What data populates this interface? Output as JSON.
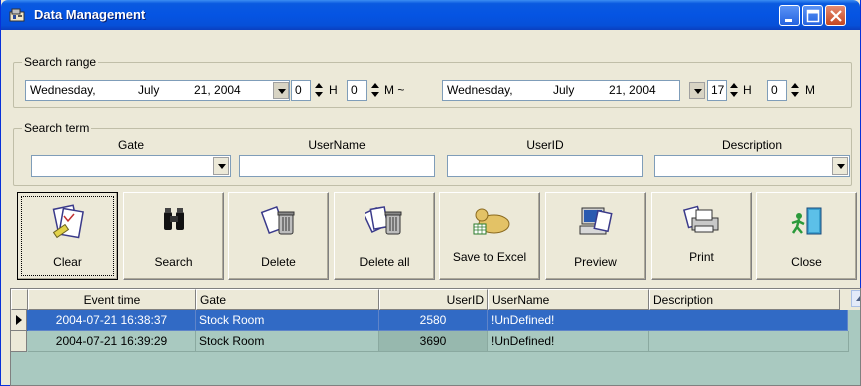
{
  "window": {
    "title": "Data Management",
    "minimize_icon": "minimize-icon",
    "maximize_icon": "maximize-icon",
    "close_icon": "close-icon"
  },
  "search_range": {
    "legend": "Search range",
    "start": {
      "weekday": "Wednesday,",
      "month": "July",
      "day_year": "21, 2004",
      "hour": "0",
      "hour_unit": "H",
      "minute": "0",
      "minute_unit": "M ~"
    },
    "end": {
      "weekday": "Wednesday,",
      "month": "July",
      "day_year": "21, 2004",
      "hour": "17",
      "hour_unit": "H",
      "minute": "0",
      "minute_unit": "M"
    }
  },
  "search_term": {
    "legend": "Search term",
    "gate_label": "Gate",
    "gate_value": "",
    "username_label": "UserName",
    "username_value": "",
    "userid_label": "UserID",
    "userid_value": "",
    "description_label": "Description",
    "description_value": ""
  },
  "toolbar": {
    "buttons": [
      {
        "label": "Clear",
        "icon": "clear-icon"
      },
      {
        "label": "Search",
        "icon": "binoculars-icon"
      },
      {
        "label": "Delete",
        "icon": "delete-icon"
      },
      {
        "label": "Delete all",
        "icon": "delete-all-icon"
      },
      {
        "label": "Save to Excel",
        "icon": "excel-icon"
      },
      {
        "label": "Preview",
        "icon": "preview-icon"
      },
      {
        "label": "Print",
        "icon": "printer-icon"
      },
      {
        "label": "Close",
        "icon": "exit-icon"
      }
    ]
  },
  "grid": {
    "columns": [
      "Event time",
      "Gate",
      "UserID",
      "UserName",
      "Description"
    ],
    "rows": [
      {
        "event_time": "2004-07-21 16:38:37",
        "gate": "Stock Room",
        "userid": "2580",
        "username": "!UnDefined!",
        "description": "",
        "selected": true
      },
      {
        "event_time": "2004-07-21 16:39:29",
        "gate": "Stock Room",
        "userid": "3690",
        "username": "!UnDefined!",
        "description": "",
        "selected": false
      }
    ]
  },
  "colors": {
    "titlebar": "#0554e3",
    "selection": "#316ac5",
    "grid_background": "#a9c9c0"
  }
}
